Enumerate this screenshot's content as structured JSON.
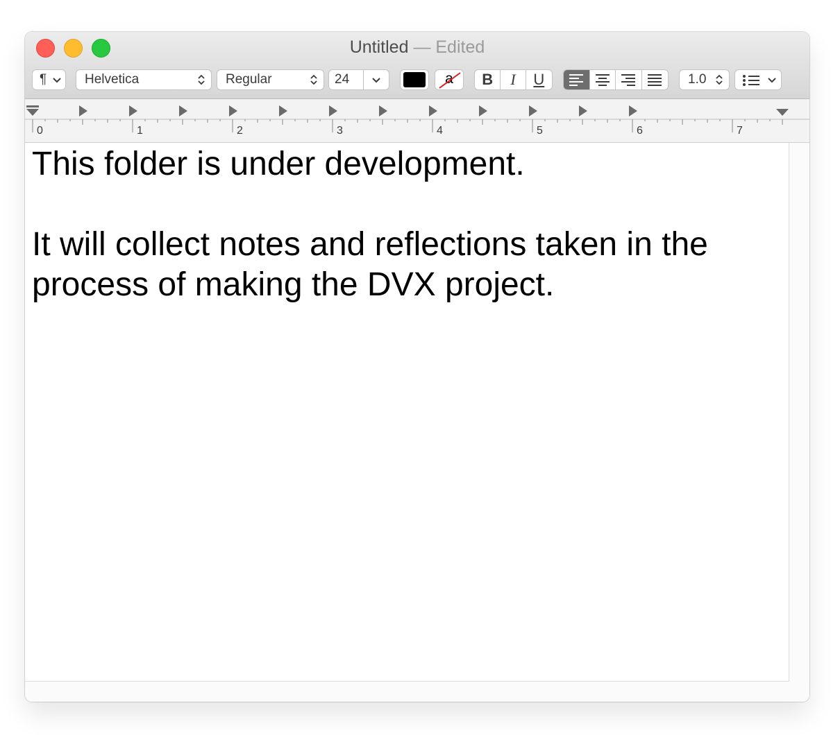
{
  "window": {
    "title": "Untitled",
    "edited_suffix": "— Edited"
  },
  "toolbar": {
    "paragraph_style_label": "¶",
    "font_family": "Helvetica",
    "font_style": "Regular",
    "font_size": "24",
    "text_color": "#000000",
    "highlight_label": "a",
    "bold_label": "B",
    "italic_label": "I",
    "underline_label": "U",
    "alignment_selected": "left",
    "line_spacing": "1.0",
    "list_icon": "bulleted-list-icon"
  },
  "ruler": {
    "labels": [
      "0",
      "1",
      "2",
      "3",
      "4",
      "5",
      "6",
      "7"
    ]
  },
  "document": {
    "paragraphs": [
      "This folder is under development.",
      "",
      "It will collect notes and reflections taken in the process of making the DVX project."
    ]
  },
  "colors": {
    "close": "#ff5f57",
    "minimize": "#febc2e",
    "zoom": "#28c840",
    "selected_segment": "#6e6e6e"
  }
}
